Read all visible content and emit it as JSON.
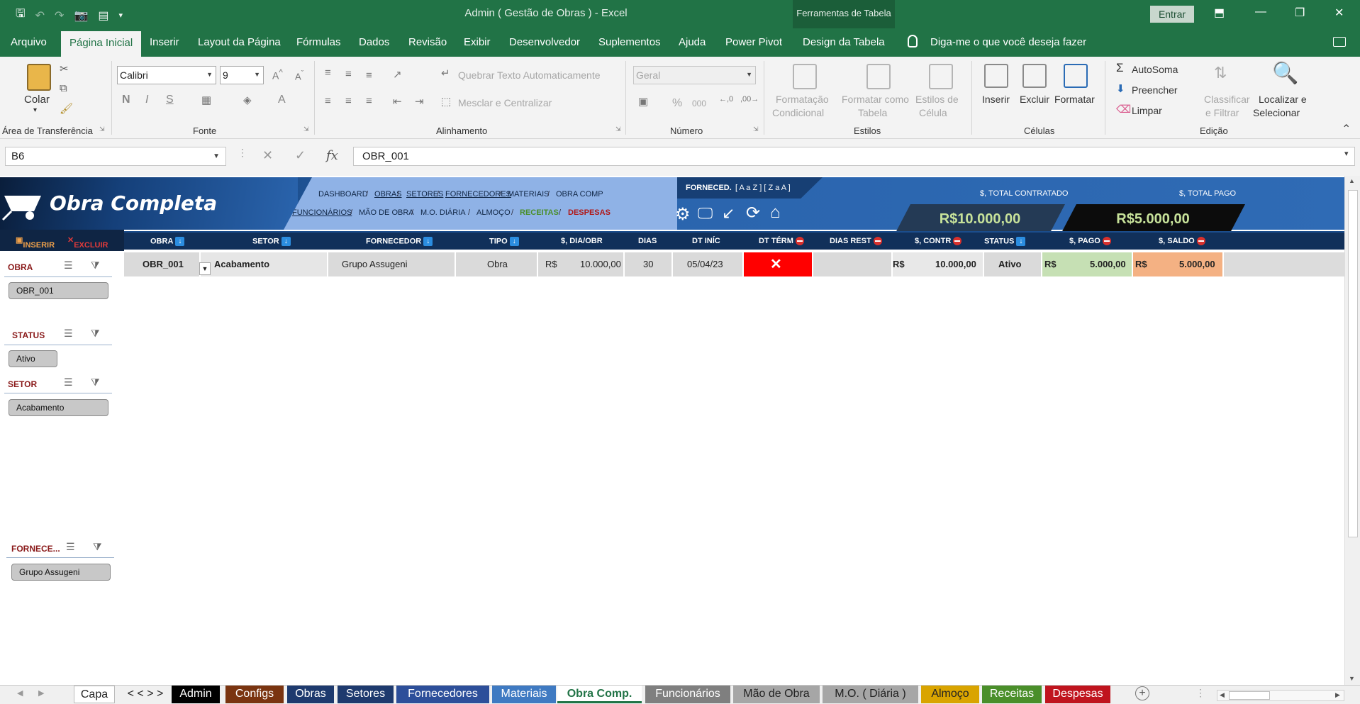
{
  "window": {
    "title": "Admin ( Gestão de Obras )  -  Excel",
    "contextual_tab": "Ferramentas de Tabela",
    "sign_in": "Entrar"
  },
  "tabs": [
    "Arquivo",
    "Página Inicial",
    "Inserir",
    "Layout da Página",
    "Fórmulas",
    "Dados",
    "Revisão",
    "Exibir",
    "Desenvolvedor",
    "Suplementos",
    "Ajuda",
    "Power Pivot",
    "Design da Tabela"
  ],
  "active_tab": "Página Inicial",
  "tell_me": "Diga-me o que você deseja fazer",
  "ribbon": {
    "clipboard": {
      "paste": "Colar",
      "label": "Área de Transferência"
    },
    "font": {
      "name": "Calibri",
      "size": "9",
      "bold": "N",
      "italic": "I",
      "underline": "S",
      "color": "A",
      "label": "Fonte"
    },
    "alignment": {
      "wrap": "Quebrar Texto Automaticamente",
      "merge": "Mesclar e Centralizar",
      "label": "Alinhamento"
    },
    "number": {
      "format": "Geral",
      "percent": "%",
      "thousands": "000",
      "label": "Número"
    },
    "styles": {
      "conditional": [
        "Formatação",
        "Condicional"
      ],
      "as_table": [
        "Formatar como",
        "Tabela"
      ],
      "cell_styles": [
        "Estilos de",
        "Célula"
      ],
      "label": "Estilos"
    },
    "cells": {
      "insert": "Inserir",
      "delete": "Excluir",
      "format": "Formatar",
      "label": "Células"
    },
    "editing": {
      "autosum": "AutoSoma",
      "fill": "Preencher",
      "clear": "Limpar",
      "sort": [
        "Classificar",
        "e Filtrar"
      ],
      "find": [
        "Localizar e",
        "Selecionar"
      ],
      "label": "Edição"
    }
  },
  "formula_bar": {
    "name_box": "B6",
    "fx": "fx",
    "value": "OBR_001"
  },
  "dashboard": {
    "title": "Obra Completa",
    "nav_row1": [
      "DASHBOARD",
      "OBRAS",
      "SETORES",
      "FORNECEDORES",
      "MATERIAIS",
      "OBRA COMP"
    ],
    "nav_row2": [
      "FUNCIONÁRIOS",
      "MÃO DE OBRA",
      "M.O. DIÁRIA",
      "ALMOÇO",
      "RECEITAS",
      "DESPESAS"
    ],
    "fornec_label": "FORNECED.",
    "fornec_sort": "[ A a Z ]  [ Z a A ]",
    "total_contratado_label": "$, TOTAL CONTRATADO",
    "total_contratado": "R$10.000,00",
    "total_pago_label": "$, TOTAL PAGO",
    "total_pago": "R$5.000,00",
    "inserir": "INSERIR",
    "excluir": "EXCLUIR",
    "colors": {
      "receitas": "#4a8f2a",
      "despesas": "#b01818",
      "valor_total": "#c7e29a"
    }
  },
  "table": {
    "headers": [
      "OBRA",
      "SETOR",
      "FORNECEDOR",
      "TIPO",
      "$, DIA/OBR",
      "DIAS",
      "DT INÍC",
      "DT TÉRM",
      "DIAS REST",
      "$, CONTR",
      "STATUS",
      "$, PAGO",
      "$, SALDO"
    ],
    "row": {
      "obra": "OBR_001",
      "setor": "Acabamento",
      "fornecedor": "Grupo Assugeni",
      "tipo": "Obra",
      "dia_obr_cur": "R$",
      "dia_obr": "10.000,00",
      "dias": "30",
      "dt_inic": "05/04/23",
      "dt_term": "✕",
      "dias_rest": "",
      "contr_cur": "R$",
      "contr": "10.000,00",
      "status": "Ativo",
      "pago_cur": "R$",
      "pago": "5.000,00",
      "saldo_cur": "R$",
      "saldo": "5.000,00"
    }
  },
  "slicers": [
    {
      "title": "OBRA",
      "item": "OBR_001"
    },
    {
      "title": "STATUS",
      "item": "Ativo"
    },
    {
      "title": "SETOR",
      "item": "Acabamento"
    },
    {
      "title": "FORNECE...",
      "item": "Grupo Assugeni"
    }
  ],
  "sheet_tabs": [
    {
      "label": "Capa",
      "color": "#ffffff"
    },
    {
      "label": "< < > >",
      "color": "#f0f0f0"
    },
    {
      "label": "Admin",
      "color": "#000000"
    },
    {
      "label": "Configs",
      "color": "#7a3410"
    },
    {
      "label": "Obras",
      "color": "#1e3a6e"
    },
    {
      "label": "Setores",
      "color": "#1e3a6e"
    },
    {
      "label": "Fornecedores",
      "color": "#2d4f9a"
    },
    {
      "label": "Materiais",
      "color": "#3f7ac2"
    },
    {
      "label": "Obra Comp.",
      "color": "#ffffff"
    },
    {
      "label": "Funcionários",
      "color": "#7f7f7f"
    },
    {
      "label": "Mão de Obra",
      "color": "#a6a6a6"
    },
    {
      "label": "M.O. ( Diária )",
      "color": "#a6a6a6"
    },
    {
      "label": "Almoço",
      "color": "#d9a400"
    },
    {
      "label": "Receitas",
      "color": "#4a8f2a"
    },
    {
      "label": "Despesas",
      "color": "#c0141e"
    }
  ],
  "active_sheet": "Obra Comp."
}
